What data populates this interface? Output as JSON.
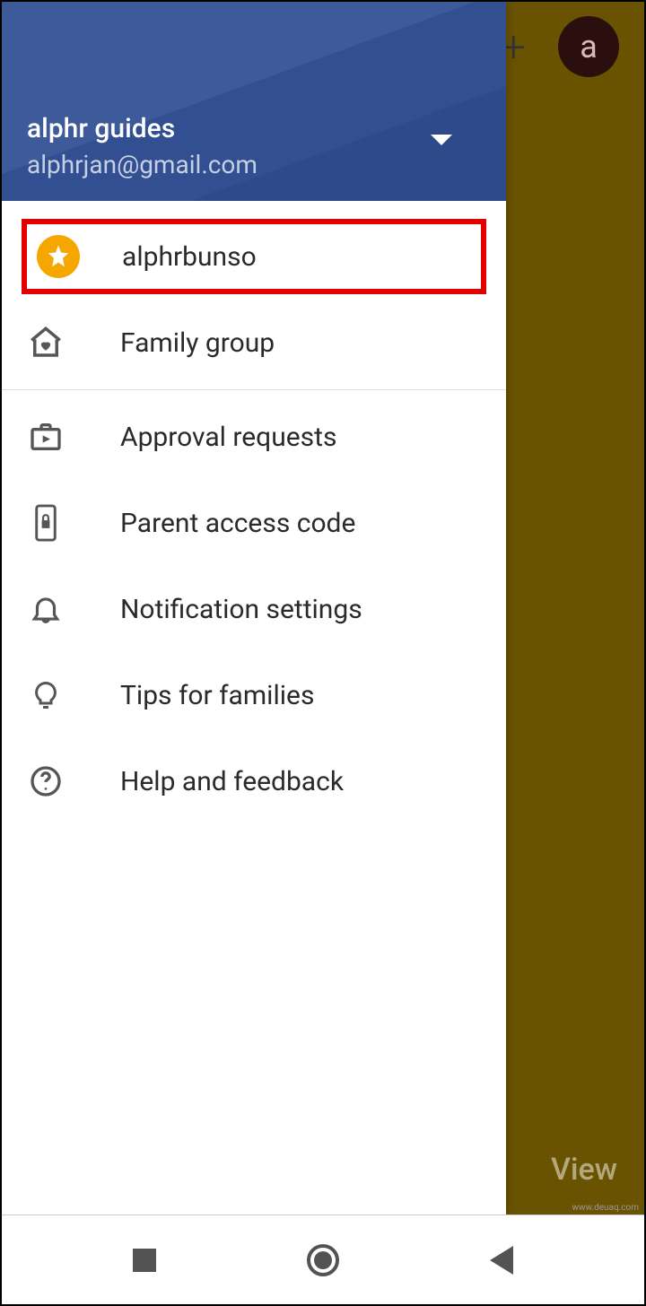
{
  "topbar": {
    "avatar_letter": "a",
    "view_label": "View"
  },
  "drawer": {
    "account_name": "alphr guides",
    "account_email": "alphrjan@gmail.com",
    "items": [
      {
        "label": "alphrbunso",
        "icon": "star-badge-icon",
        "highlighted": true
      },
      {
        "label": "Family group",
        "icon": "home-heart-icon"
      },
      {
        "label": "Approval requests",
        "icon": "briefcase-play-icon"
      },
      {
        "label": "Parent access code",
        "icon": "phone-lock-icon"
      },
      {
        "label": "Notification settings",
        "icon": "bell-icon"
      },
      {
        "label": "Tips for families",
        "icon": "lightbulb-icon"
      },
      {
        "label": "Help and feedback",
        "icon": "help-circle-icon"
      }
    ]
  },
  "watermark": "www.deuaq.com"
}
